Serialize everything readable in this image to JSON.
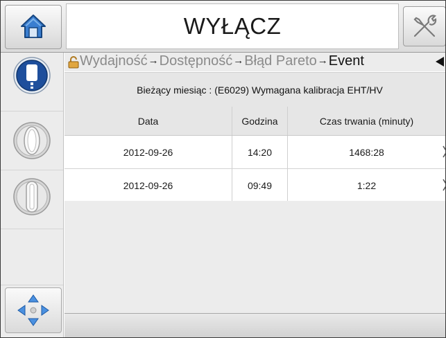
{
  "header": {
    "title": "WYŁĄCZ",
    "home_icon": "home-icon",
    "tools_icon": "wrench-screwdriver-icon"
  },
  "sidebar": {
    "items": [
      {
        "name": "printer-status-icon",
        "active": true
      },
      {
        "name": "rotary-knob-icon",
        "active": false
      },
      {
        "name": "rotary-knob-icon",
        "active": false
      },
      {
        "name": "blank",
        "active": false
      }
    ],
    "nav_icon": "navigation-arrows-icon"
  },
  "breadcrumb": {
    "lock_icon": "lock-icon",
    "items": [
      "Wydajność",
      "Dostępność",
      "Błąd Pareto",
      "Event"
    ],
    "separator": "→",
    "back_icon": "back-arrow-icon"
  },
  "subtitle": "Bieżący miesiąc : (E6029) Wymagana kalibracja EHT/HV",
  "table": {
    "headers": [
      "Data",
      "Godzina",
      "Czas trwania (minuty)"
    ],
    "rows": [
      [
        "2012-09-26",
        "14:20",
        "1468:28"
      ],
      [
        "2012-09-26",
        "09:49",
        "1:22"
      ]
    ]
  },
  "colors": {
    "accent": "#1e4f9c",
    "home_blue": "#3a7ed0",
    "background": "#ececec"
  }
}
